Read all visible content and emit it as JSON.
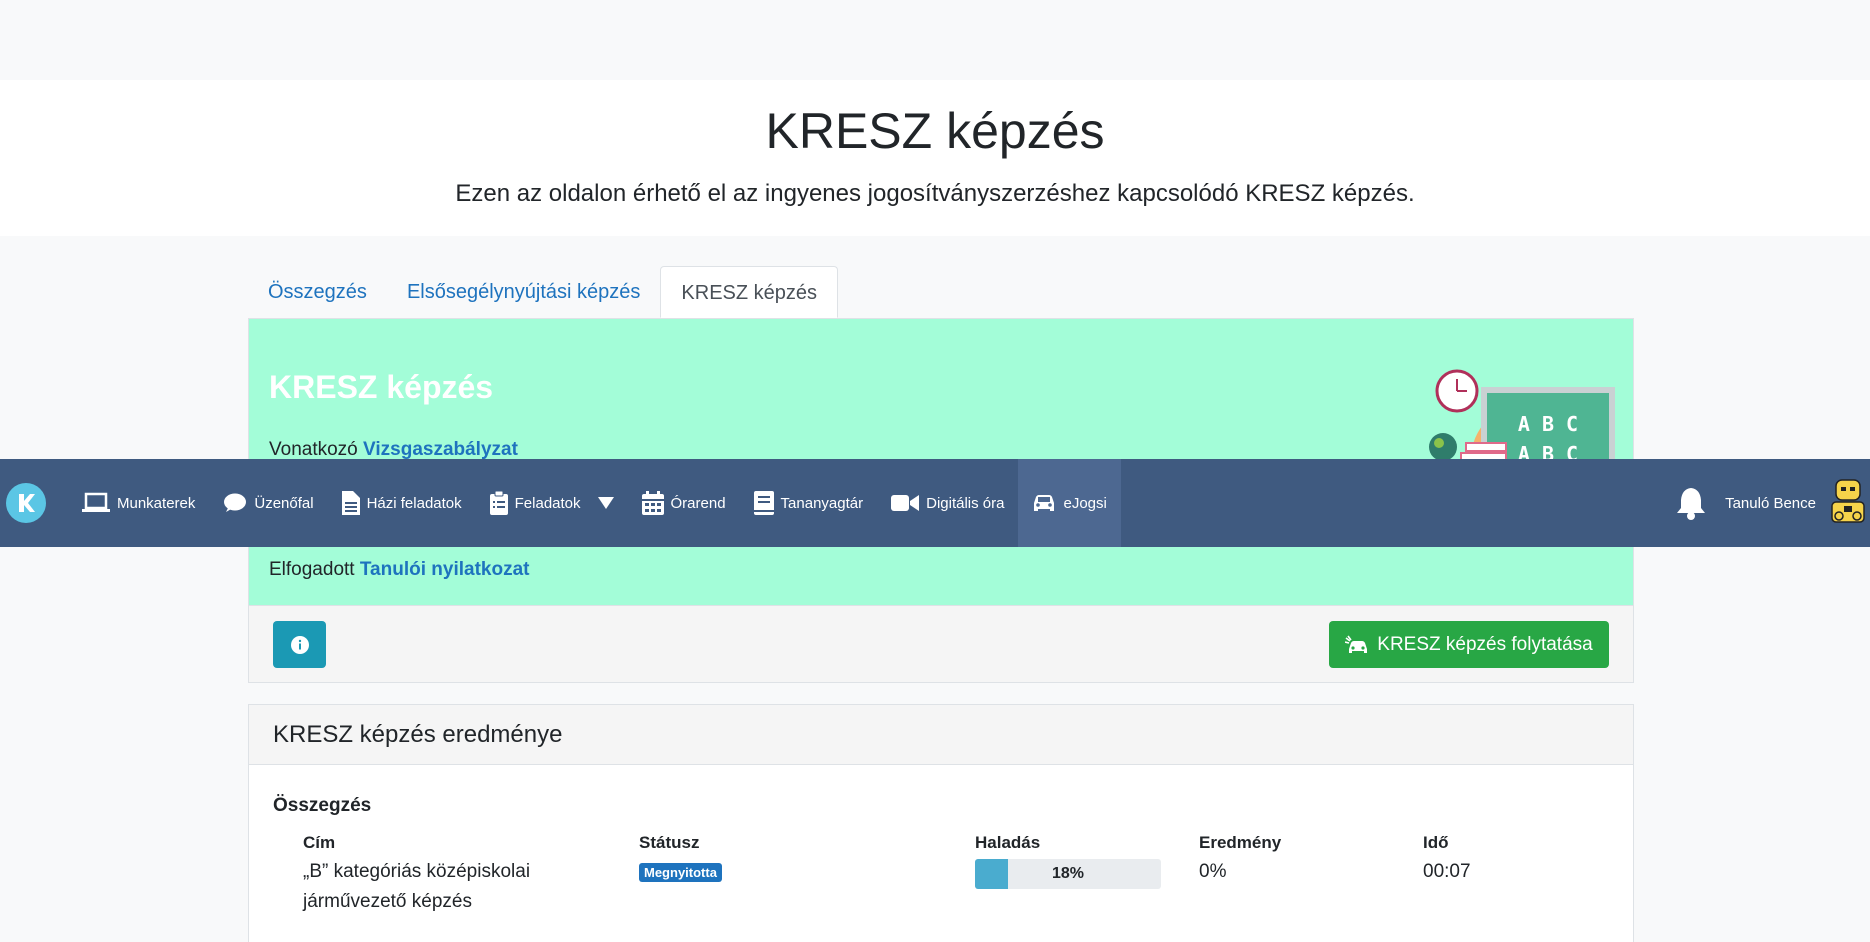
{
  "hero": {
    "title": "KRESZ képzés",
    "subtitle": "Ezen az oldalon érhető el az ingyenes jogosítványszerzéshez kapcsolódó KRESZ képzés."
  },
  "tabs": [
    {
      "label": "Összegzés"
    },
    {
      "label": "Elsősegélynyújtási képzés"
    },
    {
      "label": "KRESZ képzés"
    }
  ],
  "card": {
    "title": "KRESZ képzés",
    "line1_prefix": "Vonatkozó",
    "line1_link": "Vizsgaszabályzat",
    "line2_prefix": "Elfogadott",
    "line2_link": "Tanulói nyilatkozat",
    "illustration_text": [
      "A B C",
      "A B C"
    ],
    "continue_button": "KRESZ képzés folytatása"
  },
  "results": {
    "header": "KRESZ képzés eredménye",
    "section": "Összegzés",
    "columns": {
      "title": "Cím",
      "status": "Státusz",
      "progress": "Haladás",
      "result": "Eredmény",
      "time": "Idő"
    },
    "row": {
      "title_line1": "„B” kategóriás középiskolai",
      "title_line2": "járművezető képzés",
      "status": "Megnyitotta",
      "progress_label": "18%",
      "progress_value": 18,
      "result": "0%",
      "time": "00:07"
    }
  },
  "navbar": {
    "items": [
      {
        "label": "Munkaterek",
        "icon": "laptop-icon"
      },
      {
        "label": "Üzenőfal",
        "icon": "chat-icon"
      },
      {
        "label": "Házi feladatok",
        "icon": "file-icon"
      },
      {
        "label": "Feladatok",
        "icon": "clipboard-icon"
      },
      {
        "label": "Órarend",
        "icon": "calendar-icon"
      },
      {
        "label": "Tananyagtár",
        "icon": "book-icon"
      },
      {
        "label": "Digitális óra",
        "icon": "video-icon"
      },
      {
        "label": "eJogsi",
        "icon": "car-icon"
      }
    ],
    "user": "Tanuló Bence"
  },
  "colors": {
    "navbar": "#3f5a80",
    "mint": "#a3fdd8",
    "link": "#1e73be",
    "success": "#28a745",
    "info": "#1b99b4"
  }
}
